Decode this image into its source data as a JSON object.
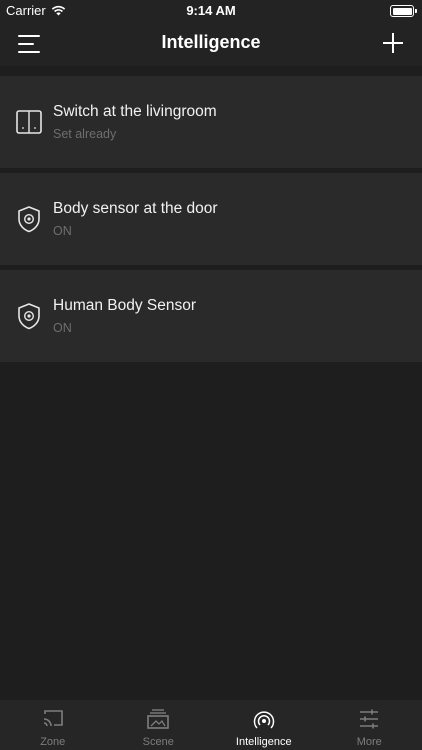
{
  "status_bar": {
    "carrier": "Carrier",
    "time": "9:14 AM"
  },
  "header": {
    "title": "Intelligence"
  },
  "items": [
    {
      "title": "Switch at the livingroom",
      "subtitle": "Set already",
      "icon": "switch-panel-icon"
    },
    {
      "title": "Body sensor at the door",
      "subtitle": "ON",
      "icon": "shield-sensor-icon"
    },
    {
      "title": "Human Body Sensor",
      "subtitle": "ON",
      "icon": "shield-sensor-icon"
    }
  ],
  "tabs": [
    {
      "label": "Zone",
      "icon": "cast-icon",
      "active": false
    },
    {
      "label": "Scene",
      "icon": "scene-image-icon",
      "active": false
    },
    {
      "label": "Intelligence",
      "icon": "broadcast-icon",
      "active": true
    },
    {
      "label": "More",
      "icon": "sliders-icon",
      "active": false
    }
  ],
  "colors": {
    "background": "#1e1e1e",
    "card": "#2a2a2a",
    "bar": "#232323",
    "muted_text": "#6e6e6e"
  }
}
